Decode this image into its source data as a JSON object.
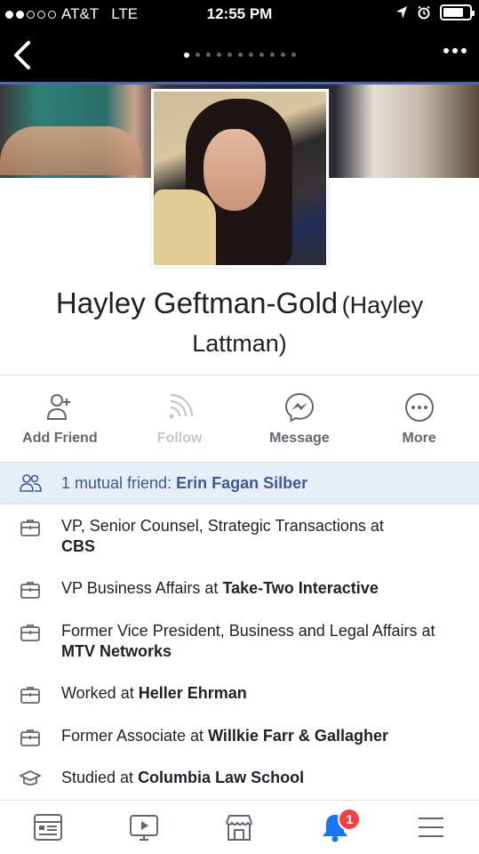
{
  "status_bar": {
    "carrier": "AT&T",
    "network": "LTE",
    "time": "12:55 PM"
  },
  "icons": {
    "back": "chevron-left-icon",
    "more": "ellipsis-icon"
  },
  "profile": {
    "name": "Hayley Geftman-Gold",
    "alternate_name": "(Hayley Lattman)"
  },
  "actions": [
    {
      "label": "Add Friend",
      "icon": "add-friend-icon",
      "enabled": true
    },
    {
      "label": "Follow",
      "icon": "follow-icon",
      "enabled": false
    },
    {
      "label": "Message",
      "icon": "messenger-icon",
      "enabled": true
    },
    {
      "label": "More",
      "icon": "more-icon",
      "enabled": true
    }
  ],
  "mutual": {
    "prefix": "1 mutual friend: ",
    "friend": "Erin Fagan Silber"
  },
  "info": [
    {
      "icon": "briefcase-icon",
      "prefix": "VP, Senior Counsel, Strategic Transactions at",
      "org": "CBS"
    },
    {
      "icon": "briefcase-icon",
      "prefix": "VP Business Affairs at ",
      "org": "Take-Two Interactive"
    },
    {
      "icon": "briefcase-icon",
      "prefix": "Former Vice President, Business and Legal Affairs at ",
      "org": "MTV Networks"
    },
    {
      "icon": "briefcase-icon",
      "prefix": "Worked at ",
      "org": "Heller Ehrman"
    },
    {
      "icon": "briefcase-icon",
      "prefix": "Former Associate at ",
      "org": "Willkie Farr & Gallagher"
    },
    {
      "icon": "graduation-cap-icon",
      "prefix": "Studied at ",
      "org": "Columbia Law School"
    }
  ],
  "tab_bar": {
    "notification_count": "1",
    "tabs": [
      "news-feed-icon",
      "video-icon",
      "marketplace-icon",
      "notifications-icon",
      "menu-icon"
    ]
  },
  "colors": {
    "link": "#3b5998",
    "highlight_bg": "#e8eef8",
    "badge": "#fa3e3e",
    "notification_blue": "#1877f2"
  }
}
